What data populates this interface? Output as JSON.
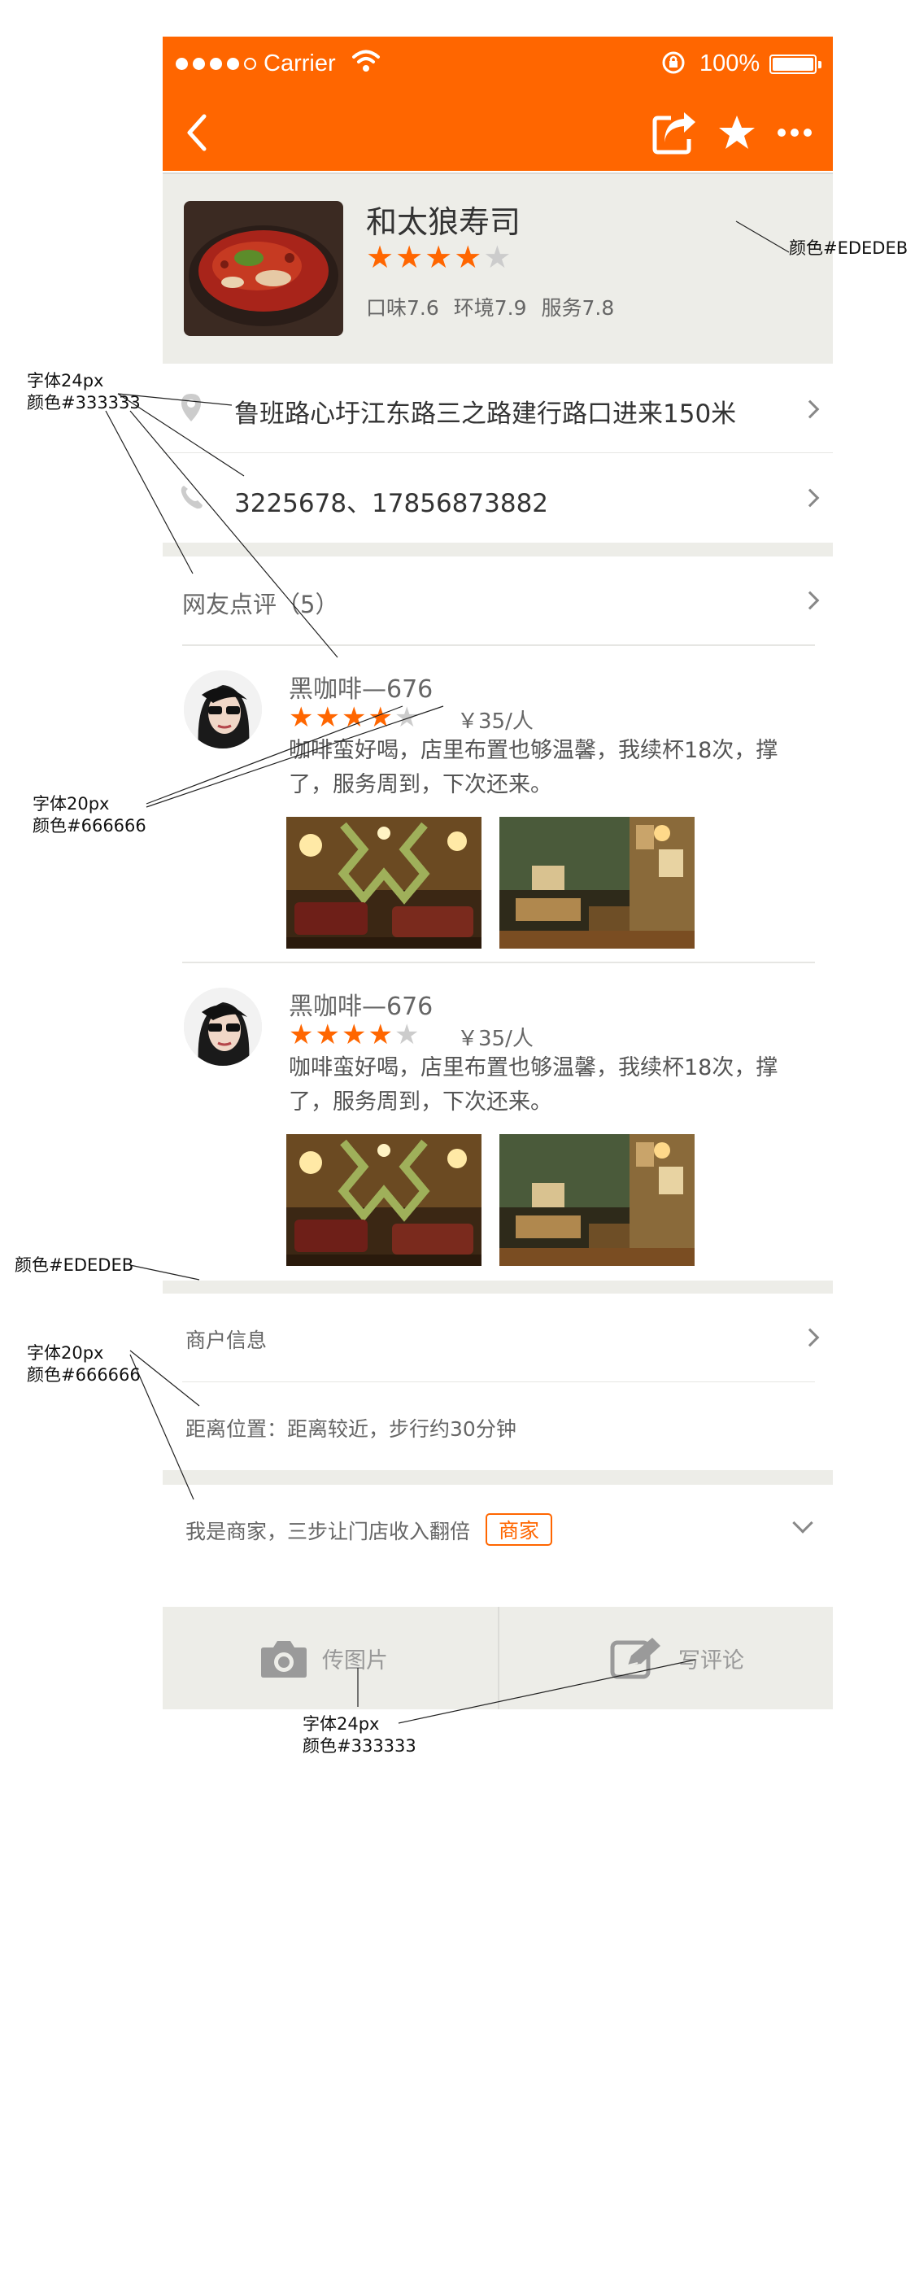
{
  "status_bar": {
    "carrier": "Carrier",
    "battery_percent": "100%",
    "signal_dots_filled": 4,
    "signal_dots_total": 5
  },
  "nav_bar": {
    "back_icon": "chevron-left-icon",
    "share_icon": "share-icon",
    "favorite_icon": "star-icon",
    "more_icon": "more-icon",
    "background": "#FF6600"
  },
  "shop": {
    "name": "和太狼寿司",
    "rating": 4,
    "rating_max": 5,
    "scores": {
      "taste": "口味7.6",
      "environment": "环境7.9",
      "service": "服务7.8"
    },
    "header_color": "#EDEDEB"
  },
  "info": {
    "address": "鲁班路心圩江东路三之路建行路口进来150米",
    "phone": "3225678、17856873882"
  },
  "reviews": {
    "title": "网友点评（5）",
    "items": [
      {
        "user": "黑咖啡—676",
        "rating": 4,
        "price": "￥35/人",
        "text_line1": "咖啡蛮好喝，店里布置也够温馨，我续杯18次，撑",
        "text_line2": "了，服务周到，下次还来。"
      },
      {
        "user": "黑咖啡—676",
        "rating": 4,
        "price": "￥35/人",
        "text_line1": "咖啡蛮好喝，店里布置也够温馨，我续杯18次，撑",
        "text_line2": "了，服务周到，下次还来。"
      }
    ]
  },
  "merchant": {
    "title": "商户信息",
    "distance": "距离位置：距离较近，步行约30分钟",
    "owner_prompt": "我是商家，三步让门店收入翻倍",
    "owner_badge": "商家"
  },
  "actions": {
    "upload_label": "传图片",
    "review_label": "写评论"
  },
  "annotations": {
    "header_color": "颜色#EDEDEB",
    "info_font_size": "字体24px",
    "info_font_color": "颜色#333333",
    "review_font_size": "字体20px",
    "review_font_color": "颜色#666666",
    "band_color": "颜色#EDEDEB",
    "merchant_font_size": "字体20px",
    "merchant_font_color": "颜色#666666",
    "action_font_size": "字体24px",
    "action_font_color": "颜色#333333"
  },
  "colors": {
    "accent": "#FF6600",
    "band": "#EDEDEB",
    "text_primary": "#333333",
    "text_secondary": "#666666"
  }
}
